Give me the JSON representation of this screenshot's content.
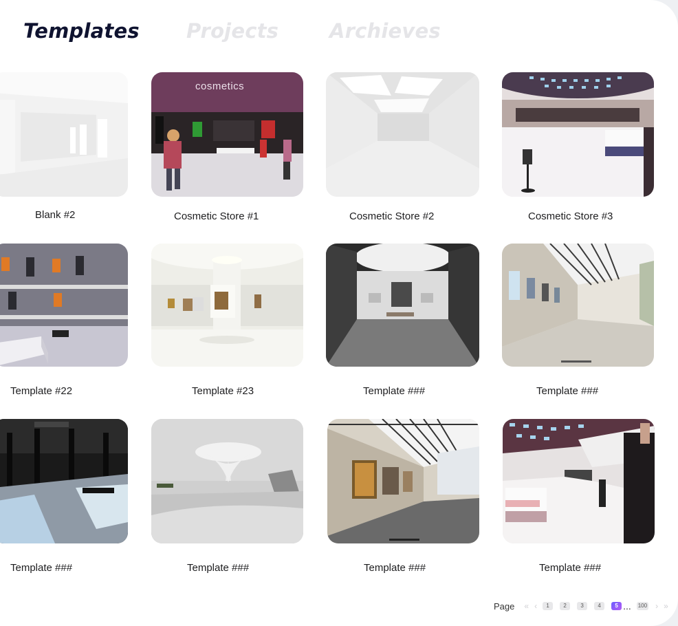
{
  "tabs": [
    {
      "label": "Templates",
      "active": true
    },
    {
      "label": "Projects",
      "active": false
    },
    {
      "label": "Archieves",
      "active": false
    }
  ],
  "templates": [
    {
      "name": "Blank #2"
    },
    {
      "name": "Cosmetic Store #1",
      "sign": "cosmetics"
    },
    {
      "name": "Cosmetic Store #2"
    },
    {
      "name": "Cosmetic Store #3"
    },
    {
      "name": "Template #22"
    },
    {
      "name": "Template #23"
    },
    {
      "name": "Template ###"
    },
    {
      "name": "Template ###"
    },
    {
      "name": "Template ###"
    },
    {
      "name": "Template ###"
    },
    {
      "name": "Template ###"
    },
    {
      "name": "Template ###"
    }
  ],
  "pagination": {
    "label": "Page",
    "pages": [
      "1",
      "2",
      "3",
      "4",
      "5"
    ],
    "current": "5",
    "ellipsis": "...",
    "last": "100",
    "first_icon": "«",
    "prev_icon": "‹",
    "next_icon": "›",
    "last_icon": "»"
  },
  "colors": {
    "active_tab": "#0f1330",
    "inactive_tab": "#e5e5e8",
    "current_page": "#7a5cff"
  }
}
